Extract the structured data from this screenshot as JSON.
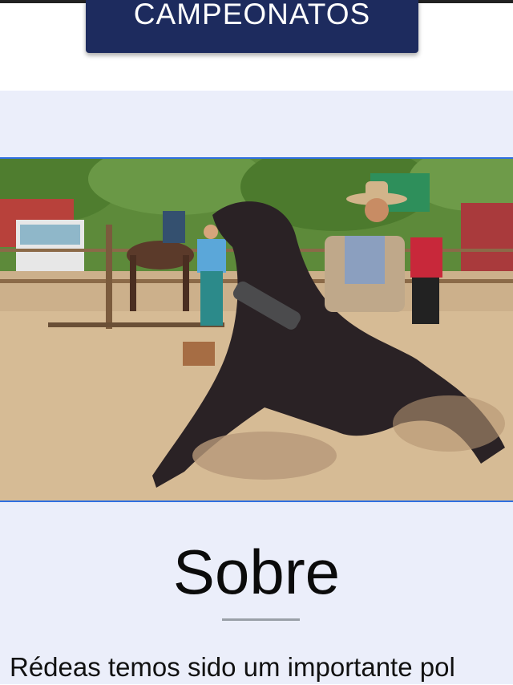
{
  "header": {
    "cta_label": "CAMPEONATOS"
  },
  "about": {
    "title": "Sobre",
    "intro_text": "Rédeas temos sido um importante pol"
  },
  "colors": {
    "cta_background": "#1d2b5e",
    "section_background": "#ebeefa",
    "photo_border": "#2f6fe0",
    "divider": "#9aa0a8"
  }
}
